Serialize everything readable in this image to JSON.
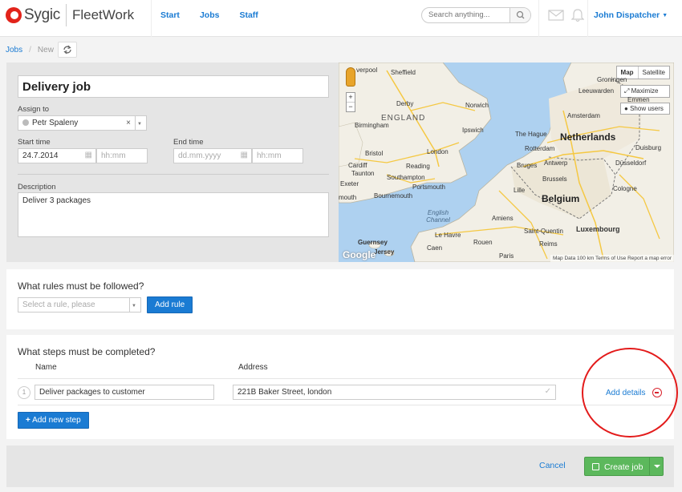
{
  "header": {
    "brand": "Sygic",
    "product": "FleetWork",
    "nav": [
      "Start",
      "Jobs",
      "Staff"
    ],
    "search_placeholder": "Search anything...",
    "user": "John Dispatcher"
  },
  "breadcrumb": {
    "parent": "Jobs",
    "current": "New"
  },
  "job": {
    "title": "Delivery job",
    "assign_label": "Assign to",
    "assignee": "Petr Spaleny",
    "start_label": "Start time",
    "start_date": "24.7.2014",
    "start_time_placeholder": "hh:mm",
    "end_label": "End time",
    "end_date_placeholder": "dd.mm.yyyy",
    "end_time_placeholder": "hh:mm",
    "description_label": "Description",
    "description": "Deliver 3 packages"
  },
  "map": {
    "type_map": "Map",
    "type_satellite": "Satellite",
    "maximize": "Maximize",
    "show_users": "Show users",
    "zoom_in": "+",
    "zoom_out": "−",
    "footer": "Map Data   100 km        Terms of Use   Report a map error",
    "google": "Google",
    "labels": {
      "liverpool": "verpool",
      "sheffield": "Sheffield",
      "groningen": "Groningen",
      "derby": "Derby",
      "leeuwarden": "Leeuwarden",
      "emmen": "Emmen",
      "norwich": "Norwich",
      "england": "ENGLAND",
      "birmingham": "Birmingham",
      "amsterdam": "Amsterdam",
      "ipswich": "Ipswich",
      "thehague": "The Hague",
      "netherlands": "Netherlands",
      "bristol": "Bristol",
      "london": "London",
      "rotterdam": "Rotterdam",
      "cardiff": "Cardiff",
      "reading": "Reading",
      "duisburg": "Duisburg",
      "taunton": "Taunton",
      "southampton": "Southampton",
      "bruges": "Bruges",
      "antwerp": "Antwerp",
      "exeter": "Exeter",
      "portsmouth": "Portsmouth",
      "bournemouth": "Bournemouth",
      "brussels": "Brussels",
      "dusseldorf": "Düsseldorf",
      "lille": "Lille",
      "belgium": "Belgium",
      "cologne": "Cologne",
      "englishchannel": "English Channel",
      "amiens": "Amiens",
      "stquentin": "Saint-Quentin",
      "luxembourg": "Luxembourg",
      "guernsey": "Guernsey",
      "jersey": "Jersey",
      "lehavre": "Le Havre",
      "rouen": "Rouen",
      "caen": "Caen",
      "reims": "Reims",
      "paris": "Paris",
      "plymouth": "mouth"
    }
  },
  "rules": {
    "heading": "What rules must be followed?",
    "select_placeholder": "Select a rule, please",
    "add_button": "Add rule"
  },
  "steps": {
    "heading": "What steps must be completed?",
    "col_name": "Name",
    "col_address": "Address",
    "items": [
      {
        "num": "1",
        "name": "Deliver packages to customer",
        "address": "221B Baker Street, london"
      }
    ],
    "add_details": "Add details",
    "add_step": "Add new step"
  },
  "footer": {
    "cancel": "Cancel",
    "create": "Create job"
  }
}
